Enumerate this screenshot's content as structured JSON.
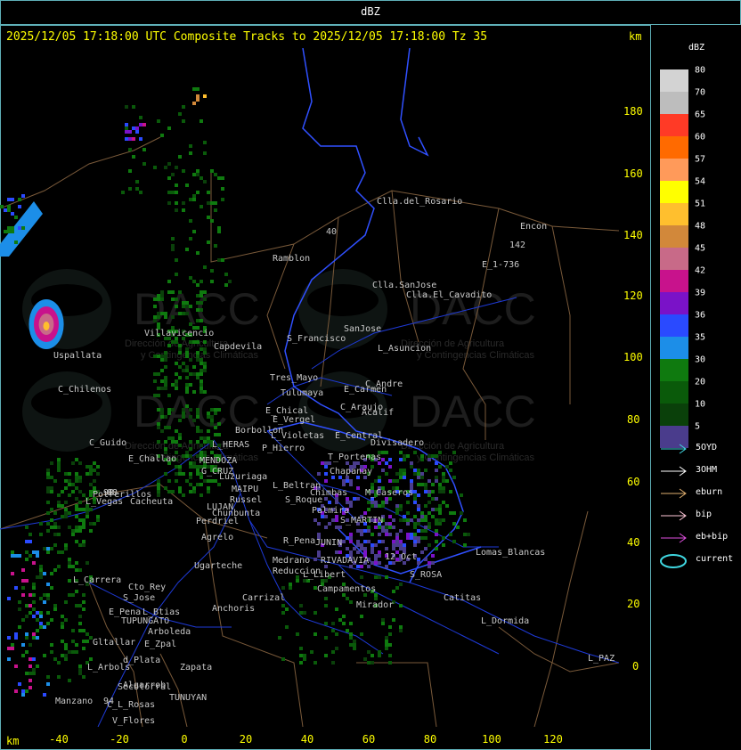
{
  "header": {
    "title": "dBZ",
    "track_title": "2025/12/05 17:18:00 UTC Composite Tracks to 2025/12/05 17:18:00 Tz 35",
    "km_label": "km"
  },
  "axes": {
    "x_ticks": [
      "-40",
      "-20",
      "0",
      "20",
      "40",
      "60",
      "80",
      "100",
      "120"
    ],
    "y_ticks": [
      "180",
      "160",
      "140",
      "120",
      "100",
      "80",
      "60",
      "40",
      "20",
      "0"
    ],
    "x_unit": "km",
    "y_unit": "km"
  },
  "watermark": {
    "brand": "DACC",
    "line1": "Dirección de Agricultura",
    "line2": "y Contingencias Climáticas"
  },
  "towns": [
    "Clla.del_Rosario",
    "Encon",
    "142",
    "E_1-736",
    "Ramblon",
    "Clla.SanJose",
    "Clla.El_Cavadito",
    "Villavicencio",
    "Capdevila",
    "S_Francisco",
    "SanJose",
    "L_Asuncion",
    "Uspallata",
    "C_Chilenos",
    "Tres_Mayo",
    "C_Andre",
    "Tulumaya",
    "E_Carmen",
    "E_Chical",
    "C_Araujo",
    "E_Vergel",
    "Acalif",
    "Borbollon",
    "E_Central",
    "L_Violetas",
    "Divisadero",
    "L_HERAS",
    "P_Hierro",
    "C_Guido",
    "E_Challao",
    "MENDOZA",
    "T_Portenas",
    "G_CRUZ",
    "Chapanay",
    "Luzuriaga",
    "L_Beltran",
    "Chimbas",
    "M_Caseros",
    "Potrerillos",
    "MAIPU",
    "Russel",
    "S_Roque",
    "L_Vegas",
    "Cacheuta",
    "LUJAN",
    "Palmira",
    "Chunbunta",
    "S_MARTIN",
    "Perdriel",
    "Agrelo",
    "R_Pena",
    "JUNIN",
    "Lomas_Blancas",
    "Ugarteche",
    "Medrano",
    "RIVADAVIA",
    "12_Oct",
    "Reduccion",
    "L_Libert",
    "S_ROSA",
    "L_Carrera",
    "Cto_Rey",
    "S_Jose",
    "Campamentos",
    "Carrizal",
    "Catitas",
    "Anchoris",
    "E_Pena",
    "L_Btias",
    "Mirador",
    "TUPUNGATO",
    "L_Dormida",
    "Arboleda",
    "Gltallar",
    "E_Zpal",
    "d_Plata",
    "L_Arbols",
    "Zapata",
    "L_PAZ",
    "Algarrob",
    "Secotorral",
    "TUNUYAN",
    "Manzano",
    "C_L_Rosas",
    "V_Flores",
    "40",
    "98",
    "94",
    "88"
  ],
  "legend": {
    "title": "dBZ",
    "colors": [
      "#d3d3d3",
      "#bdbdbd",
      "#ff3a26",
      "#ff6a00",
      "#ff9a5a",
      "#ffff00",
      "#ffbf2e",
      "#d2883a",
      "#c86a88",
      "#c8128c",
      "#7a12c8",
      "#2a4aff",
      "#1c8ee8",
      "#0f7a0f",
      "#0a5a0a",
      "#0a400a",
      "#4a3c8c"
    ],
    "values": [
      "80",
      "70",
      "65",
      "60",
      "57",
      "54",
      "51",
      "48",
      "45",
      "42",
      "39",
      "36",
      "35",
      "30",
      "20",
      "10",
      "5"
    ]
  },
  "tracks": [
    {
      "label": "5OYD",
      "color": "#3fd6e0"
    },
    {
      "label": "3OHM",
      "color": "#ffffff"
    },
    {
      "label": "eburn",
      "color": "#e0b070"
    },
    {
      "label": "bip",
      "color": "#ffc8d8"
    },
    {
      "label": "eb+bip",
      "color": "#e050e0"
    },
    {
      "label": "current",
      "color": "#3fd6e0"
    }
  ]
}
